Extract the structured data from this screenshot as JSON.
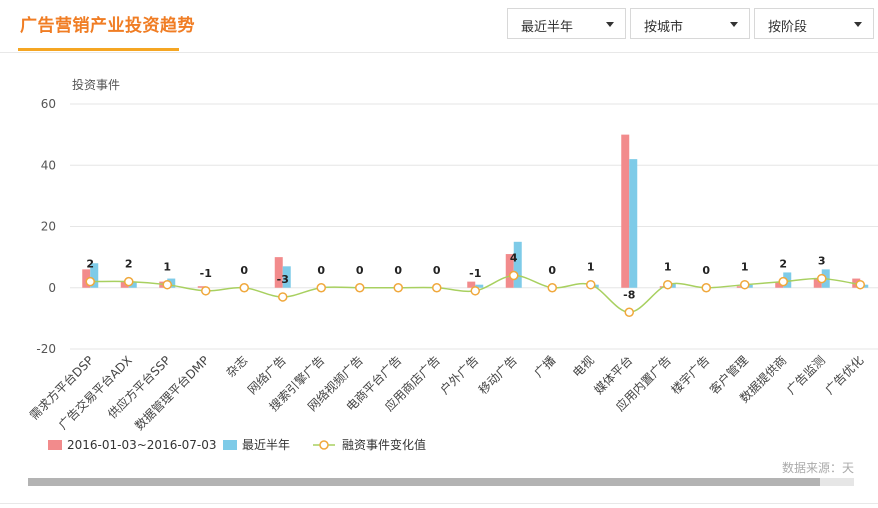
{
  "header": {
    "title": "广告营销产业投资趋势",
    "selects": [
      {
        "label": "最近半年"
      },
      {
        "label": "按城市"
      },
      {
        "label": "按阶段"
      }
    ]
  },
  "chart_data": {
    "type": "bar",
    "ylabel": "投资事件",
    "ylim": [
      -20,
      60
    ],
    "yticks": [
      60,
      40,
      20,
      0,
      -20
    ],
    "categories": [
      "需求方平台DSP",
      "广告交易平台ADX",
      "供应方平台SSP",
      "数据管理平台DMP",
      "杂志",
      "网络广告",
      "搜索引擎广告",
      "网络视频广告",
      "电商平台广告",
      "应用商店广告",
      "户外广告",
      "移动广告",
      "广播",
      "电视",
      "媒体平台",
      "应用内置广告",
      "楼宇广告",
      "客户管理",
      "数据提供商",
      "广告监测",
      "广告优化"
    ],
    "series": [
      {
        "name": "2016-01-03~2016-07-03",
        "type": "bar",
        "color": "#f28b8c",
        "values": [
          6,
          2,
          2,
          0.5,
          0,
          10,
          0,
          0,
          0,
          0,
          2,
          11,
          0,
          0,
          50,
          0.5,
          0,
          0.5,
          2,
          3,
          3
        ]
      },
      {
        "name": "最近半年",
        "type": "bar",
        "color": "#7ecbe8",
        "values": [
          8,
          2,
          3,
          0,
          0,
          7,
          0,
          0,
          0,
          0,
          1,
          15,
          0,
          1,
          42,
          1.5,
          0,
          1,
          5,
          6,
          1
        ]
      },
      {
        "name": "融资事件变化值",
        "type": "line",
        "color": "#a8d060",
        "marker_color": "#f0a83c",
        "values": [
          2,
          2,
          1,
          -1,
          0,
          -3,
          0,
          0,
          0,
          0,
          -1,
          4,
          0,
          1,
          -8,
          1,
          0,
          1,
          2,
          3,
          1
        ]
      }
    ],
    "point_labels": [
      "2",
      "2",
      "1",
      "-1",
      "0",
      "-3",
      "0",
      "0",
      "0",
      "0",
      "-1",
      "4",
      "0",
      "1",
      "-8",
      "1",
      "0",
      "1",
      "2",
      "3",
      ""
    ],
    "grid": true,
    "legend_position": "bottom-left",
    "source_note": "数据来源：天"
  }
}
